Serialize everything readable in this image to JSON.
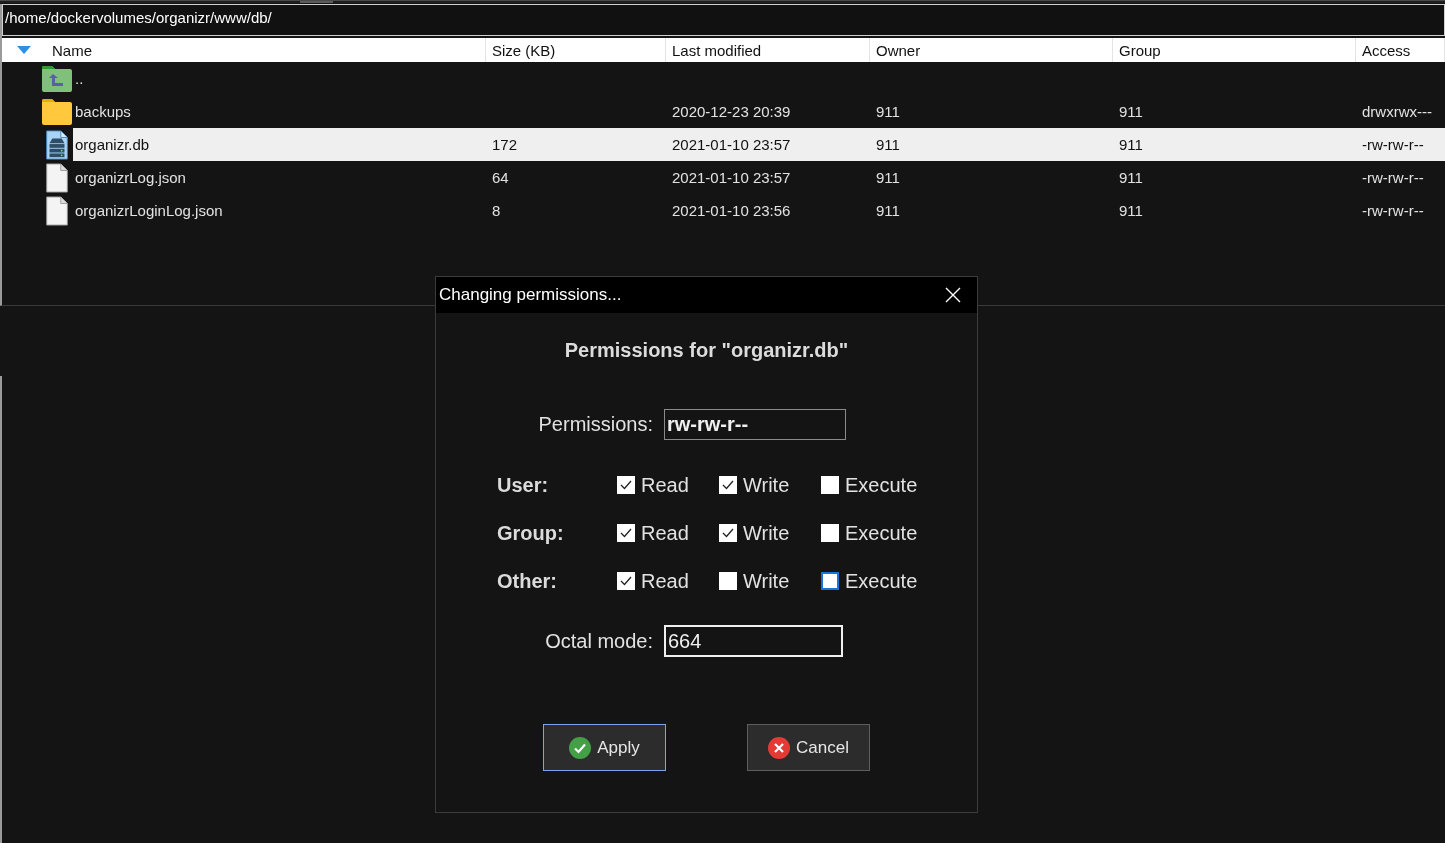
{
  "path_bar": {
    "value": "/home/dockervolumes/organizr/www/db/"
  },
  "file_list": {
    "columns": [
      {
        "label": "Name",
        "sorted": true
      },
      {
        "label": "Size (KB)",
        "sorted": false
      },
      {
        "label": "Last modified",
        "sorted": false
      },
      {
        "label": "Owner",
        "sorted": false
      },
      {
        "label": "Group",
        "sorted": false
      },
      {
        "label": "Access",
        "sorted": false
      }
    ],
    "rows": [
      {
        "kind": "parent",
        "name": "..",
        "selected": false
      },
      {
        "kind": "folder",
        "name": "backups",
        "modified": "2020-12-23 20:39",
        "owner": "911",
        "group": "911",
        "access": "drwxrwx---",
        "selected": false
      },
      {
        "kind": "database",
        "name": "organizr.db",
        "size": "172",
        "modified": "2021-01-10 23:57",
        "owner": "911",
        "group": "911",
        "access": "-rw-rw-r--",
        "selected": true
      },
      {
        "kind": "file",
        "name": "organizrLog.json",
        "size": "64",
        "modified": "2021-01-10 23:57",
        "owner": "911",
        "group": "911",
        "access": "-rw-rw-r--",
        "selected": false
      },
      {
        "kind": "file",
        "name": "organizrLoginLog.json",
        "size": "8",
        "modified": "2021-01-10 23:56",
        "owner": "911",
        "group": "911",
        "access": "-rw-rw-r--",
        "selected": false
      }
    ]
  },
  "dialog": {
    "title": "Changing permissions...",
    "heading": "Permissions for \"organizr.db\"",
    "permissions_label": "Permissions:",
    "permissions_value": "rw-rw-r--",
    "groups": [
      {
        "label": "User:",
        "options": [
          {
            "label": "Read",
            "checked": true,
            "focused": false
          },
          {
            "label": "Write",
            "checked": true,
            "focused": false
          },
          {
            "label": "Execute",
            "checked": false,
            "focused": false
          }
        ]
      },
      {
        "label": "Group:",
        "options": [
          {
            "label": "Read",
            "checked": true,
            "focused": false
          },
          {
            "label": "Write",
            "checked": true,
            "focused": false
          },
          {
            "label": "Execute",
            "checked": false,
            "focused": false
          }
        ]
      },
      {
        "label": "Other:",
        "options": [
          {
            "label": "Read",
            "checked": true,
            "focused": false
          },
          {
            "label": "Write",
            "checked": false,
            "focused": false
          },
          {
            "label": "Execute",
            "checked": false,
            "focused": true
          }
        ]
      }
    ],
    "octal_label": "Octal mode:",
    "octal_value": "664",
    "buttons": [
      {
        "kind": "apply",
        "label": "Apply",
        "default": true
      },
      {
        "kind": "cancel",
        "label": "Cancel",
        "default": false
      }
    ]
  }
}
